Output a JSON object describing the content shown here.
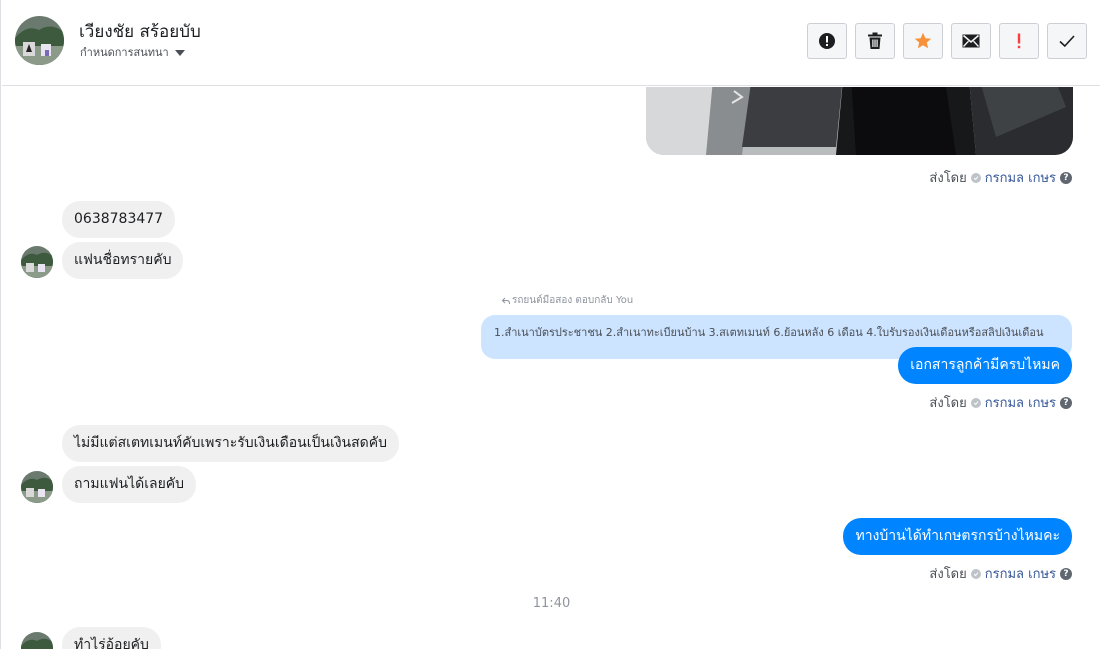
{
  "header": {
    "contact_name": "เวียงชัย สร้อยบับ",
    "conversation_settings": "กำหนดการสนทนา",
    "actions": [
      {
        "name": "mark-spam-button",
        "icon": "alert-circle-icon"
      },
      {
        "name": "delete-button",
        "icon": "trash-icon"
      },
      {
        "name": "star-button",
        "icon": "star-icon"
      },
      {
        "name": "mark-unread-button",
        "icon": "envelope-icon"
      },
      {
        "name": "priority-button",
        "icon": "exclamation-icon"
      },
      {
        "name": "mark-done-button",
        "icon": "checkmark-icon"
      }
    ]
  },
  "colors": {
    "outgoing_bubble": "#0084ff",
    "incoming_bubble": "#f1f0f0",
    "reply_quote": "#cce4ff",
    "star": "#f7923b",
    "priority": "#fa3e3e"
  },
  "messages": {
    "sent_by_label": "ส่งโดย",
    "sender_name": "กรกมล เกษร",
    "in_1": "0638783477",
    "in_2": "แฟนชื่อทรายคับ",
    "reply_label": "รถยนต์มือสอง ตอบกลับ You",
    "reply_quote": "1.สำเนาบัตรประชาชน 2.สำเนาทะเบียนบ้าน 3.สเตทเมนท์ 6.ย้อนหลัง 6 เดือน 4.ใบรับรองเงินเดือนหรือสลิปเงินเดือน",
    "out_1": "เอกสารลูกค้ามีครบไหมค",
    "in_3": "ไม่มีแต่สเตทเมนท์คับเพราะรับเงินเดือนเป็นเงินสดคับ",
    "in_4": "ถามแฟนได้เลยคับ",
    "out_2": "ทางบ้านได้ทำเกษตรกรบ้างไหมคะ",
    "time_divider": "11:40",
    "in_5": "ทำไร่อ้อยคับ"
  }
}
